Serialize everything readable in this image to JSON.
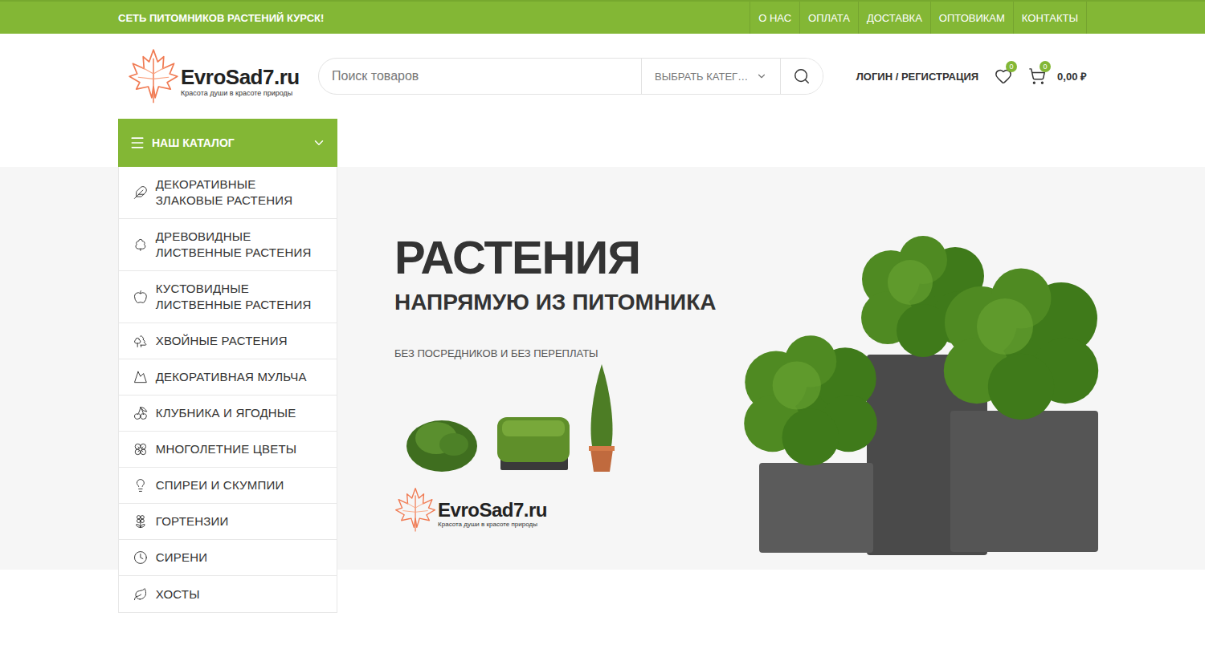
{
  "topbar": {
    "tagline": "СЕТЬ ПИТОМНИКОВ РАСТЕНИЙ КУРСК!",
    "links": [
      "О НАС",
      "ОПЛАТА",
      "ДОСТАВКА",
      "ОПТОВИКАМ",
      "КОНТАКТЫ"
    ]
  },
  "logo": {
    "name": "EvroSad7.ru",
    "tagline": "Красота души в красоте природы"
  },
  "search": {
    "placeholder": "Поиск товаров",
    "category": "ВЫБРАТЬ КАТЕГ…"
  },
  "account": {
    "login": "ЛОГИН / РЕГИСТРАЦИЯ",
    "wishlist_count": "0",
    "cart_count": "0",
    "cart_total": "0,00 ₽"
  },
  "catalog": {
    "title": "НАШ КАТАЛОГ",
    "expanded": true,
    "items": [
      "ДЕКОРАТИВНЫЕ ЗЛАКОВЫЕ РАСТЕНИЯ",
      "ДРЕВОВИДНЫЕ ЛИСТВЕННЫЕ РАСТЕНИЯ",
      "КУСТОВИДНЫЕ ЛИСТВЕННЫЕ РАСТЕНИЯ",
      "ХВОЙНЫЕ РАСТЕНИЯ",
      "ДЕКОРАТИВНАЯ МУЛЬЧА",
      "КЛУБНИКА И ЯГОДНЫЕ",
      "МНОГОЛЕТНИЕ ЦВЕТЫ",
      "СПИРЕИ И СКУМПИИ",
      "ГОРТЕНЗИИ",
      "СИРЕНИ",
      "ХОСТЫ"
    ]
  },
  "hero": {
    "title": "РАСТЕНИЯ",
    "subtitle": "НАПРЯМУЮ ИЗ ПИТОМНИКА",
    "tagline": "БЕЗ ПОСРЕДНИКОВ И БЕЗ ПЕРЕПЛАТЫ",
    "logo": {
      "name": "EvroSad7.ru",
      "tagline": "Красота души в красоте природы"
    }
  }
}
